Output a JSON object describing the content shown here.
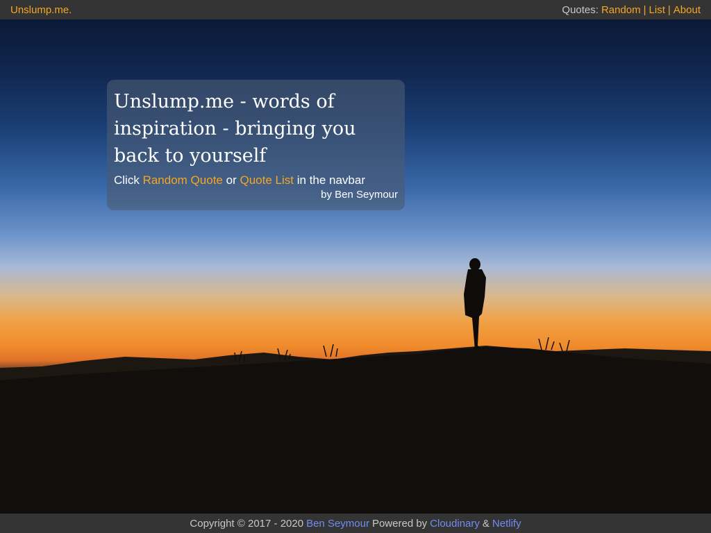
{
  "navbar": {
    "brand": "Unslump.me.",
    "quotes_prefix": "Quotes:",
    "links": [
      "Random",
      "List",
      "About"
    ],
    "separator": "|"
  },
  "intro": {
    "title": "Unslump.me - words of inspiration - bringing you back to yourself",
    "line_prefix": "Click",
    "random_quote_link": "Random Quote",
    "or_text": "or",
    "quote_list_link": "Quote List",
    "line_suffix": "in the navbar",
    "author": "by Ben Seymour"
  },
  "footer": {
    "copyright": "Copyright © 2017 - 2020",
    "author_link": "Ben Seymour",
    "powered_by": "Powered by",
    "cloudinary_link": "Cloudinary",
    "amp": "&",
    "netlify_link": "Netlify"
  },
  "background": {
    "image": "silhouette-person-on-hill-at-sunset"
  },
  "colors": {
    "accent": "#f5a623",
    "footer_link": "#6f8ef0",
    "bar_bg": "#343434"
  }
}
